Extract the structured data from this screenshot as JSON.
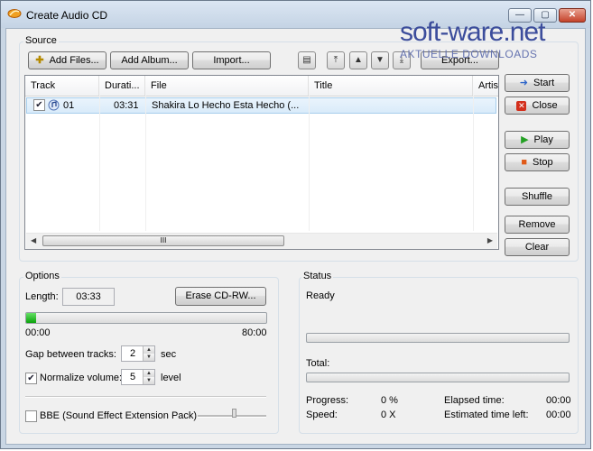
{
  "window": {
    "title": "Create Audio CD"
  },
  "watermark": {
    "brand": "soft-ware.net",
    "tagline": "AKTUELLE DOWNLOADS"
  },
  "source": {
    "label": "Source",
    "buttons": {
      "add_files": "Add Files...",
      "add_album": "Add Album...",
      "import": "Import...",
      "export": "Export..."
    },
    "columns": [
      "Track",
      "Durati...",
      "File",
      "Title",
      "Artis"
    ],
    "rows": [
      {
        "checked": true,
        "track": "01",
        "duration": "03:31",
        "file": "Shakira Lo Hecho Esta Hecho (...",
        "title": "",
        "artist": ""
      }
    ]
  },
  "side_buttons": {
    "start": "Start",
    "close": "Close",
    "play": "Play",
    "stop": "Stop",
    "shuffle": "Shuffle",
    "remove": "Remove",
    "clear": "Clear"
  },
  "options": {
    "label": "Options",
    "length_label": "Length:",
    "length_value": "03:33",
    "erase_button": "Erase CD-RW...",
    "capacity_used_fraction": 0.04,
    "capacity_start": "00:00",
    "capacity_end": "80:00",
    "gap_label": "Gap between tracks:",
    "gap_value": "2",
    "gap_unit": "sec",
    "normalize_checked": true,
    "normalize_label": "Normalize volume:",
    "normalize_value": "5",
    "normalize_unit": "level",
    "bbe_checked": false,
    "bbe_label": "BBE (Sound Effect Extension Pack)"
  },
  "status": {
    "label": "Status",
    "state": "Ready",
    "total_label": "Total:",
    "progress_label": "Progress:",
    "progress_value": "0 %",
    "speed_label": "Speed:",
    "speed_value": "0 X",
    "elapsed_label": "Elapsed time:",
    "elapsed_value": "00:00",
    "remaining_label": "Estimated time left:",
    "remaining_value": "00:00"
  }
}
